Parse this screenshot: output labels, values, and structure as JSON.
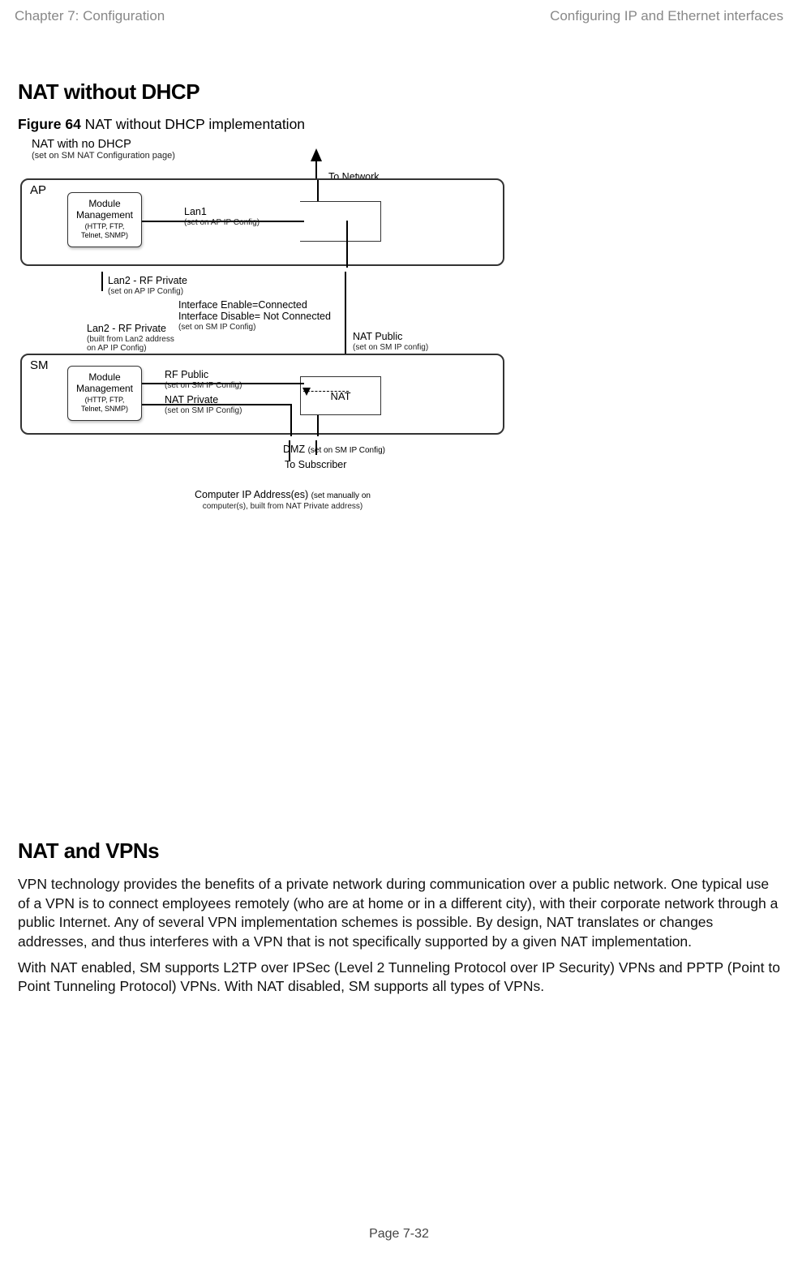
{
  "header": {
    "left": "Chapter 7:  Configuration",
    "right": "Configuring IP and Ethernet interfaces"
  },
  "sections": {
    "nat_without_dhcp": {
      "heading": "NAT without DHCP",
      "figure_label": "Figure 64",
      "figure_caption": " NAT without DHCP implementation"
    },
    "nat_and_vpns": {
      "heading": "NAT and VPNs",
      "para1": "VPN technology provides the benefits of a private network during communication over a public network. One typical use of a VPN is to connect employees remotely (who are at home or in a different city), with their corporate network through a public Internet. Any of several VPN implementation schemes is possible. By design, NAT translates or changes addresses, and thus interferes with a VPN that is not specifically supported by a given NAT implementation.",
      "para2": "With NAT enabled, SM supports L2TP over IPSec (Level 2 Tunneling Protocol over IP Security) VPNs and PPTP (Point to Point Tunneling Protocol) VPNs. With NAT disabled, SM supports all types of VPNs."
    }
  },
  "diagram": {
    "title": "NAT with no DHCP",
    "subtitle": "(set on SM NAT Configuration page)",
    "to_network": "To Network",
    "ap_label": "AP",
    "sm_label": "SM",
    "module": {
      "line1": "Module",
      "line2": "Management",
      "line3": "(HTTP, FTP,",
      "line4": "Telnet, SNMP)"
    },
    "lan1": {
      "label": "Lan1",
      "caption": "(set on AP IP Config)"
    },
    "lan2_rf_private_a": {
      "label": "Lan2 - RF Private",
      "caption": "(set on AP IP Config)"
    },
    "interface": {
      "line1": "Interface Enable=Connected",
      "line2": "Interface Disable= Not Connected",
      "caption": "(set on SM IP Config)"
    },
    "lan2_rf_private_b": {
      "label": "Lan2 - RF Private",
      "caption1": "(built from Lan2 address",
      "caption2": "on AP IP Config)"
    },
    "nat_public": {
      "label": "NAT Public",
      "caption": "(set on SM IP config)"
    },
    "rf_public": {
      "label": "RF Public",
      "caption": "(set on SM IP Config)"
    },
    "nat_private": {
      "label": "NAT Private",
      "caption": "(set on SM IP Config)"
    },
    "nat_box": "NAT",
    "dmz": {
      "label": "DMZ",
      "caption": "(set on SM IP Config)"
    },
    "to_subscriber": "To Subscriber",
    "computer_ip": {
      "label": "Computer IP Address(es)",
      "caption1": "(set manually on",
      "caption2": "computer(s), built from NAT Private address)"
    }
  },
  "footer": {
    "page": "Page 7-32"
  }
}
